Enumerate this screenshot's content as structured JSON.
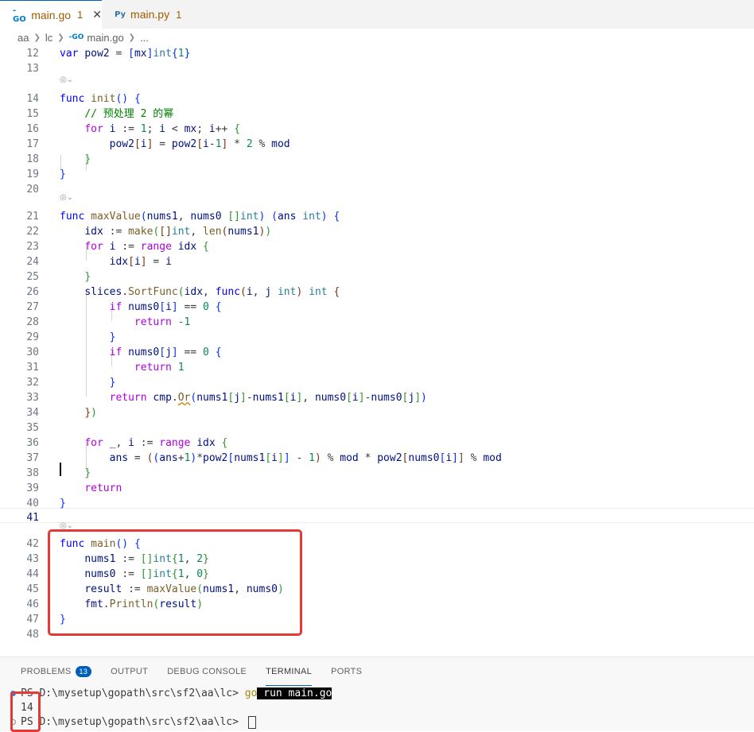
{
  "tabs": [
    {
      "name": "main.go",
      "count": "1",
      "icon": "go-file-icon",
      "close": "✕"
    },
    {
      "name": "main.py",
      "count": "1",
      "icon": "python-file-icon"
    }
  ],
  "breadcrumb": [
    "aa",
    "lc",
    "main.go",
    "..."
  ],
  "editor": {
    "line_numbers": [
      "12",
      "13",
      "14",
      "15",
      "16",
      "17",
      "18",
      "19",
      "20",
      "21",
      "22",
      "23",
      "24",
      "25",
      "26",
      "27",
      "28",
      "29",
      "30",
      "31",
      "32",
      "33",
      "34",
      "35",
      "36",
      "37",
      "38",
      "39",
      "40",
      "41",
      "42",
      "43",
      "44",
      "45",
      "46",
      "47",
      "48"
    ],
    "lens_icon": "references-icon"
  },
  "panel": {
    "tabs": [
      "PROBLEMS",
      "OUTPUT",
      "DEBUG CONSOLE",
      "TERMINAL",
      "PORTS"
    ],
    "problems_count": "13",
    "terminal": {
      "prompt1": "PS D:\\mysetup\\gopath\\src\\sf2\\aa\\lc> ",
      "cmd_go": "go",
      "cmd_rest": " run main.go",
      "output": "14",
      "prompt2": "PS D:\\mysetup\\gopath\\src\\sf2\\aa\\lc> "
    }
  },
  "colors": {
    "accent": "#005fb8",
    "highlight_box": "#e53935",
    "modified_tab": "#a15c00"
  }
}
